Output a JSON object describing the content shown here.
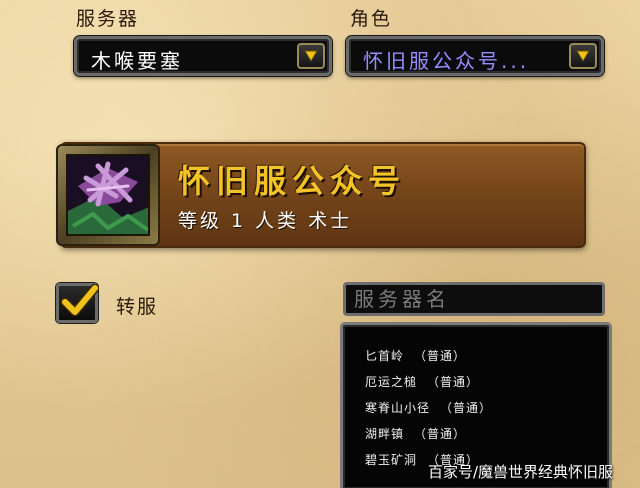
{
  "server_section": {
    "label": "服务器",
    "selected": "木喉要塞"
  },
  "character_section": {
    "label": "角色",
    "selected": "怀旧服公众号..."
  },
  "character_card": {
    "name": "怀旧服公众号",
    "info": "等级 1 人类 术士"
  },
  "transfer": {
    "label": "转服",
    "checked": true
  },
  "server_search": {
    "placeholder": "服务器名"
  },
  "server_list": [
    {
      "name": "匕首岭",
      "type": "（普通）"
    },
    {
      "name": "厄运之槌",
      "type": "（普通）"
    },
    {
      "name": "寒脊山小径",
      "type": "（普通）"
    },
    {
      "name": "湖畔镇",
      "type": "（普通）"
    },
    {
      "name": "碧玉矿洞",
      "type": "（普通）"
    }
  ],
  "watermark": "百家号/魔兽世界经典怀旧服",
  "colors": {
    "name_gold": "#f3c427",
    "selected_character_text": "#9a8cff",
    "banner_brown": "#76461a",
    "checkmark_yellow": "#f2c21b"
  },
  "icons": {
    "dropdown_arrow": "chevron-down-icon",
    "checkmark": "checkmark-icon",
    "portrait": "warlock-portrait-icon"
  }
}
